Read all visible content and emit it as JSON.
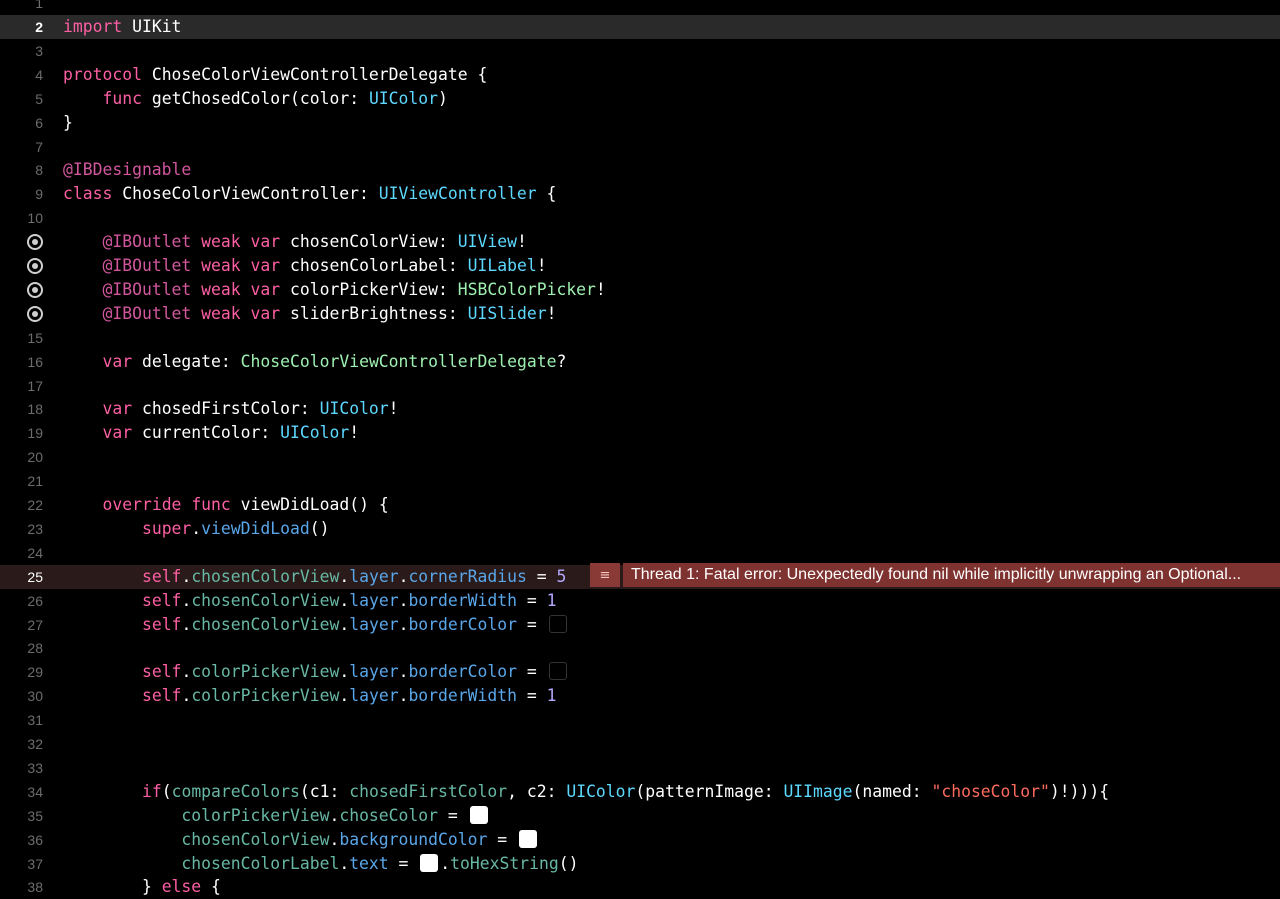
{
  "editor": {
    "current_line": 2,
    "error_line": 25,
    "error": {
      "icon": "list-icon",
      "message": "Thread 1: Fatal error: Unexpectedly found nil while implicitly unwrapping an Optional..."
    },
    "line_numbers": [
      "1",
      "2",
      "3",
      "4",
      "5",
      "6",
      "7",
      "8",
      "9",
      "10",
      "11",
      "12",
      "13",
      "14",
      "15",
      "16",
      "17",
      "18",
      "19",
      "20",
      "21",
      "22",
      "23",
      "24",
      "25",
      "26",
      "27",
      "28",
      "29",
      "30",
      "31",
      "32",
      "33",
      "34",
      "35",
      "36",
      "37",
      "38"
    ],
    "outlet_lines": [
      11,
      12,
      13,
      14
    ],
    "lines": [
      [],
      [
        [
          "kw",
          "import"
        ],
        [
          "plain",
          " UIKit"
        ]
      ],
      [],
      [
        [
          "kw",
          "protocol"
        ],
        [
          "plain",
          " ChoseColorViewControllerDelegate {"
        ]
      ],
      [
        [
          "plain",
          "    "
        ],
        [
          "kw",
          "func"
        ],
        [
          "plain",
          " getChosedColor(color: "
        ],
        [
          "type",
          "UIColor"
        ],
        [
          "plain",
          ")"
        ]
      ],
      [
        [
          "plain",
          "}"
        ]
      ],
      [],
      [
        [
          "attr",
          "@IBDesignable"
        ]
      ],
      [
        [
          "kw",
          "class"
        ],
        [
          "plain",
          " ChoseColorViewController: "
        ],
        [
          "type",
          "UIViewController"
        ],
        [
          "plain",
          " {"
        ]
      ],
      [],
      [
        [
          "plain",
          "    "
        ],
        [
          "attr",
          "@IBOutlet"
        ],
        [
          "plain",
          " "
        ],
        [
          "kw",
          "weak"
        ],
        [
          "plain",
          " "
        ],
        [
          "kw",
          "var"
        ],
        [
          "plain",
          " chosenColorView: "
        ],
        [
          "type",
          "UIView"
        ],
        [
          "plain",
          "!"
        ]
      ],
      [
        [
          "plain",
          "    "
        ],
        [
          "attr",
          "@IBOutlet"
        ],
        [
          "plain",
          " "
        ],
        [
          "kw",
          "weak"
        ],
        [
          "plain",
          " "
        ],
        [
          "kw",
          "var"
        ],
        [
          "plain",
          " chosenColorLabel: "
        ],
        [
          "type",
          "UILabel"
        ],
        [
          "plain",
          "!"
        ]
      ],
      [
        [
          "plain",
          "    "
        ],
        [
          "attr",
          "@IBOutlet"
        ],
        [
          "plain",
          " "
        ],
        [
          "kw",
          "weak"
        ],
        [
          "plain",
          " "
        ],
        [
          "kw",
          "var"
        ],
        [
          "plain",
          " colorPickerView: "
        ],
        [
          "type-proj",
          "HSBColorPicker"
        ],
        [
          "plain",
          "!"
        ]
      ],
      [
        [
          "plain",
          "    "
        ],
        [
          "attr",
          "@IBOutlet"
        ],
        [
          "plain",
          " "
        ],
        [
          "kw",
          "weak"
        ],
        [
          "plain",
          " "
        ],
        [
          "kw",
          "var"
        ],
        [
          "plain",
          " sliderBrightness: "
        ],
        [
          "type",
          "UISlider"
        ],
        [
          "plain",
          "!"
        ]
      ],
      [],
      [
        [
          "plain",
          "    "
        ],
        [
          "kw",
          "var"
        ],
        [
          "plain",
          " delegate: "
        ],
        [
          "type-proj",
          "ChoseColorViewControllerDelegate"
        ],
        [
          "plain",
          "?"
        ]
      ],
      [],
      [
        [
          "plain",
          "    "
        ],
        [
          "kw",
          "var"
        ],
        [
          "plain",
          " chosedFirstColor: "
        ],
        [
          "type",
          "UIColor"
        ],
        [
          "plain",
          "!"
        ]
      ],
      [
        [
          "plain",
          "    "
        ],
        [
          "kw",
          "var"
        ],
        [
          "plain",
          " currentColor: "
        ],
        [
          "type",
          "UIColor"
        ],
        [
          "plain",
          "!"
        ]
      ],
      [],
      [],
      [
        [
          "plain",
          "    "
        ],
        [
          "kw",
          "override"
        ],
        [
          "plain",
          " "
        ],
        [
          "kw",
          "func"
        ],
        [
          "plain",
          " viewDidLoad() {"
        ]
      ],
      [
        [
          "plain",
          "        "
        ],
        [
          "kw",
          "super"
        ],
        [
          "plain",
          "."
        ],
        [
          "sys-prop",
          "viewDidLoad"
        ],
        [
          "plain",
          "()"
        ]
      ],
      [],
      [
        [
          "plain",
          "        "
        ],
        [
          "kw",
          "self"
        ],
        [
          "plain",
          "."
        ],
        [
          "prop",
          "chosenColorView"
        ],
        [
          "plain",
          "."
        ],
        [
          "sys-prop",
          "layer"
        ],
        [
          "plain",
          "."
        ],
        [
          "sys-prop",
          "cornerRadius"
        ],
        [
          "plain",
          " = "
        ],
        [
          "num",
          "5"
        ]
      ],
      [
        [
          "plain",
          "        "
        ],
        [
          "kw",
          "self"
        ],
        [
          "plain",
          "."
        ],
        [
          "prop",
          "chosenColorView"
        ],
        [
          "plain",
          "."
        ],
        [
          "sys-prop",
          "layer"
        ],
        [
          "plain",
          "."
        ],
        [
          "sys-prop",
          "borderWidth"
        ],
        [
          "plain",
          " = "
        ],
        [
          "num",
          "1"
        ]
      ],
      [
        [
          "plain",
          "        "
        ],
        [
          "kw",
          "self"
        ],
        [
          "plain",
          "."
        ],
        [
          "prop",
          "chosenColorView"
        ],
        [
          "plain",
          "."
        ],
        [
          "sys-prop",
          "layer"
        ],
        [
          "plain",
          "."
        ],
        [
          "sys-prop",
          "borderColor"
        ],
        [
          "plain",
          " = "
        ],
        [
          "swatch",
          "dark"
        ]
      ],
      [],
      [
        [
          "plain",
          "        "
        ],
        [
          "kw",
          "self"
        ],
        [
          "plain",
          "."
        ],
        [
          "prop",
          "colorPickerView"
        ],
        [
          "plain",
          "."
        ],
        [
          "sys-prop",
          "layer"
        ],
        [
          "plain",
          "."
        ],
        [
          "sys-prop",
          "borderColor"
        ],
        [
          "plain",
          " = "
        ],
        [
          "swatch",
          "dark"
        ]
      ],
      [
        [
          "plain",
          "        "
        ],
        [
          "kw",
          "self"
        ],
        [
          "plain",
          "."
        ],
        [
          "prop",
          "colorPickerView"
        ],
        [
          "plain",
          "."
        ],
        [
          "sys-prop",
          "layer"
        ],
        [
          "plain",
          "."
        ],
        [
          "sys-prop",
          "borderWidth"
        ],
        [
          "plain",
          " = "
        ],
        [
          "num",
          "1"
        ]
      ],
      [],
      [],
      [],
      [
        [
          "plain",
          "        "
        ],
        [
          "kw",
          "if"
        ],
        [
          "plain",
          "("
        ],
        [
          "prop",
          "compareColors"
        ],
        [
          "plain",
          "(c1: "
        ],
        [
          "prop",
          "chosedFirstColor"
        ],
        [
          "plain",
          ", c2: "
        ],
        [
          "type",
          "UIColor"
        ],
        [
          "plain",
          "(patternImage: "
        ],
        [
          "type",
          "UIImage"
        ],
        [
          "plain",
          "(named: "
        ],
        [
          "str",
          "\"choseColor\""
        ],
        [
          "plain",
          ")!))){"
        ]
      ],
      [
        [
          "plain",
          "            "
        ],
        [
          "prop",
          "colorPickerView"
        ],
        [
          "plain",
          "."
        ],
        [
          "prop",
          "choseColor"
        ],
        [
          "plain",
          " = "
        ],
        [
          "swatch",
          "white"
        ]
      ],
      [
        [
          "plain",
          "            "
        ],
        [
          "prop",
          "chosenColorView"
        ],
        [
          "plain",
          "."
        ],
        [
          "sys-prop",
          "backgroundColor"
        ],
        [
          "plain",
          " = "
        ],
        [
          "swatch",
          "white"
        ]
      ],
      [
        [
          "plain",
          "            "
        ],
        [
          "prop",
          "chosenColorLabel"
        ],
        [
          "plain",
          "."
        ],
        [
          "sys-prop",
          "text"
        ],
        [
          "plain",
          " = "
        ],
        [
          "swatch",
          "white"
        ],
        [
          "plain",
          "."
        ],
        [
          "prop",
          "toHexString"
        ],
        [
          "plain",
          "()"
        ]
      ],
      [
        [
          "plain",
          "        } "
        ],
        [
          "kw",
          "else"
        ],
        [
          "plain",
          " {"
        ]
      ]
    ]
  }
}
